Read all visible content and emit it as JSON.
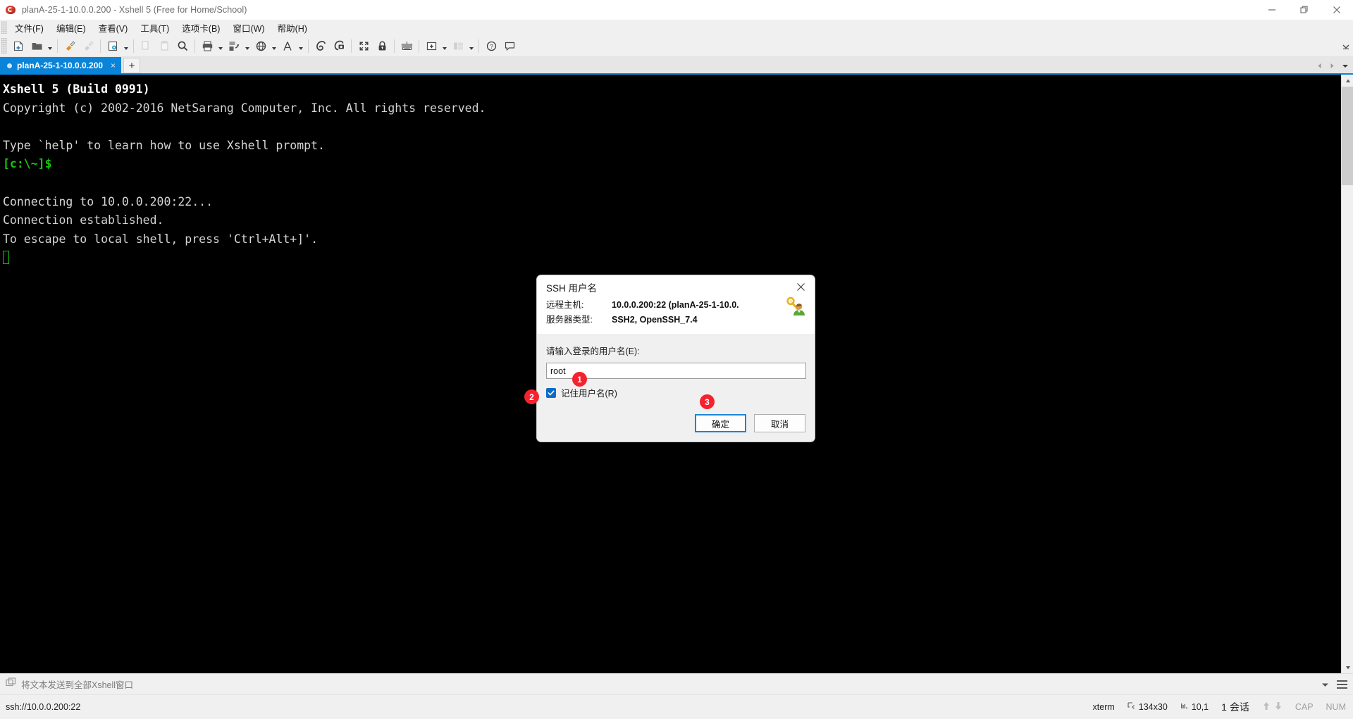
{
  "window": {
    "title": "planA-25-1-10.0.0.200 - Xshell 5 (Free for Home/School)",
    "app_icon": "xshell-shell-icon",
    "minimize_label": "最小化",
    "restore_label": "还原",
    "close_label": "关闭"
  },
  "menubar": {
    "items": [
      {
        "label": "文件(F)",
        "name": "menu-file"
      },
      {
        "label": "编辑(E)",
        "name": "menu-edit"
      },
      {
        "label": "查看(V)",
        "name": "menu-view"
      },
      {
        "label": "工具(T)",
        "name": "menu-tools"
      },
      {
        "label": "选项卡(B)",
        "name": "menu-tabs"
      },
      {
        "label": "窗口(W)",
        "name": "menu-window"
      },
      {
        "label": "帮助(H)",
        "name": "menu-help"
      }
    ]
  },
  "toolbar": {
    "icons": [
      "new-session-icon",
      "open-folder-icon",
      "connect-icon",
      "disconnect-icon",
      "session-properties-icon",
      "copy-icon",
      "paste-icon",
      "find-icon",
      "print-icon",
      "file-transfer-icon",
      "globe-icon",
      "font-icon",
      "log-icon",
      "capture-icon",
      "fullscreen-icon",
      "lock-icon",
      "keyboard-icon",
      "new-tab-icon",
      "arrange-icon",
      "help-icon",
      "feedback-icon"
    ],
    "overflow_label": "更多按钮"
  },
  "tabs": {
    "items": [
      {
        "label": "planA-25-1-10.0.0.200",
        "active": true,
        "close_glyph": "×"
      }
    ],
    "new_tab_glyph": "+",
    "accent_color": "#0a84d8"
  },
  "terminal": {
    "lines": [
      {
        "text": "Xshell 5 (Build 0991)",
        "style": "bold"
      },
      {
        "text": "Copyright (c) 2002-2016 NetSarang Computer, Inc. All rights reserved.",
        "style": "normal"
      },
      {
        "text": "",
        "style": "blank"
      },
      {
        "text": "Type `help' to learn how to use Xshell prompt.",
        "style": "normal"
      },
      {
        "text": "[c:\\~]$",
        "style": "green"
      },
      {
        "text": "",
        "style": "blank"
      },
      {
        "text": "Connecting to 10.0.0.200:22...",
        "style": "normal"
      },
      {
        "text": "Connection established.",
        "style": "normal"
      },
      {
        "text": "To escape to local shell, press 'Ctrl+Alt+]'.",
        "style": "normal"
      }
    ],
    "background_color": "#000000",
    "foreground_color": "#d4d4d4",
    "prompt_color": "#16c60c",
    "cursor": "block-cursor"
  },
  "dialog": {
    "title": "SSH 用户名",
    "close_glyph": "✕",
    "icon": "key-user-icon",
    "info": [
      {
        "key": "远程主机:",
        "value": "10.0.0.200:22 (planA-25-1-10.0."
      },
      {
        "key": "服务器类型:",
        "value": "SSH2, OpenSSH_7.4"
      }
    ],
    "prompt": "请输入登录的用户名(E):",
    "username_value": "root",
    "username_placeholder": "",
    "remember_label": "记住用户名(R)",
    "remember_checked": true,
    "ok_label": "确定",
    "cancel_label": "取消"
  },
  "badges": [
    {
      "number": "1",
      "target": "username-input"
    },
    {
      "number": "2",
      "target": "remember-checkbox"
    },
    {
      "number": "3",
      "target": "ok-button"
    }
  ],
  "sendbar": {
    "icon": "windows-stack-icon",
    "label": "将文本发送到全部Xshell窗口",
    "caret": "chevron-down-icon",
    "menu": "hamburger-icon"
  },
  "statusbar": {
    "left": "ssh://10.0.0.200:22",
    "term_type": "xterm",
    "size_icon": "resize-icon",
    "size": "134x30",
    "cursor_icon": "cursor-pos-icon",
    "cursor_pos": "10,1",
    "sessions": "1 会话",
    "up_icon": "arrow-up-icon",
    "down_icon": "arrow-down-icon",
    "cap": "CAP",
    "num": "NUM"
  }
}
